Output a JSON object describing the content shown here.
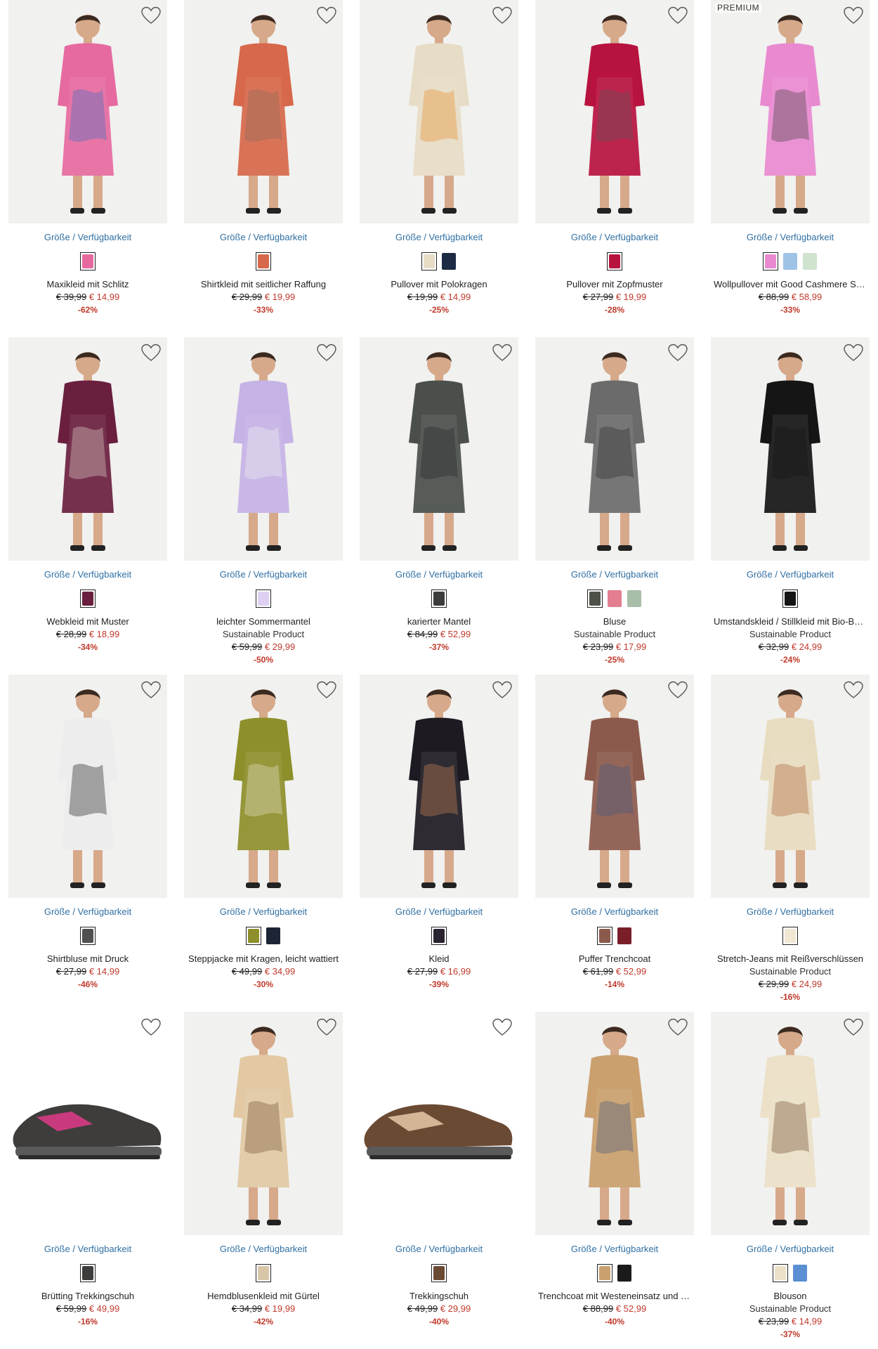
{
  "size_link_label": "Größe / Verfügbarkeit",
  "products": [
    {
      "name": "Maxikleid mit Schlitz",
      "old_price": "€ 39,99",
      "new_price": "€ 14,99",
      "discount": "-62%",
      "badge": "",
      "sustainable": "",
      "bg": "#f1f1ef",
      "garment": "#e66aa0",
      "accent": "#3a6fc4",
      "shoe": false,
      "swatches": [
        "#e66aa0"
      ]
    },
    {
      "name": "Shirtkleid mit seitlicher Raffung",
      "old_price": "€ 29,99",
      "new_price": "€ 19,99",
      "discount": "-33%",
      "badge": "",
      "sustainable": "",
      "bg": "#f1f1ef",
      "garment": "#d7684b",
      "accent": "#8a6a5a",
      "shoe": false,
      "swatches": [
        "#d7684b"
      ]
    },
    {
      "name": "Pullover mit Polokragen",
      "old_price": "€ 19,99",
      "new_price": "€ 14,99",
      "discount": "-25%",
      "badge": "",
      "sustainable": "",
      "bg": "#f1f1ef",
      "garment": "#e7dcc6",
      "accent": "#e8891f",
      "shoe": false,
      "swatches": [
        "#e7dcc6",
        "#1d2a45"
      ]
    },
    {
      "name": "Pullover mit Zopfmuster",
      "old_price": "€ 27,99",
      "new_price": "€ 19,99",
      "discount": "-28%",
      "badge": "",
      "sustainable": "",
      "bg": "#f1f1ef",
      "garment": "#b8123f",
      "accent": "#555555",
      "shoe": false,
      "swatches": [
        "#b8123f"
      ]
    },
    {
      "name": "Wollpullover mit Good Cashmere Standard®-Anteil",
      "old_price": "€ 88,99",
      "new_price": "€ 58,99",
      "discount": "-33%",
      "badge": "PREMIUM",
      "sustainable": "",
      "bg": "#f1f1ef",
      "garment": "#e98ad0",
      "accent": "#3b3b3b",
      "shoe": false,
      "swatches": [
        "#e98ad0",
        "#9ec3e6",
        "#cfe3cf"
      ]
    },
    {
      "name": "Webkleid mit Muster",
      "old_price": "€ 28,99",
      "new_price": "€ 18,99",
      "discount": "-34%",
      "badge": "",
      "sustainable": "",
      "bg": "#f1f1ef",
      "garment": "#6a1f3f",
      "accent": "#e7ddd0",
      "shoe": false,
      "swatches": [
        "#6a1f3f"
      ]
    },
    {
      "name": "leichter Sommermantel",
      "old_price": "€ 59,99",
      "new_price": "€ 29,99",
      "discount": "-50%",
      "badge": "",
      "sustainable": "Sustainable Product",
      "bg": "#f1f1ef",
      "garment": "#c6b3e6",
      "accent": "#f1f1f1",
      "shoe": false,
      "swatches": [
        "#ddd0f2"
      ]
    },
    {
      "name": "karierter Mantel",
      "old_price": "€ 84,99",
      "new_price": "€ 52,99",
      "discount": "-37%",
      "badge": "",
      "sustainable": "",
      "bg": "#f1f1ef",
      "garment": "#4a4f4c",
      "accent": "#222222",
      "shoe": false,
      "swatches": [
        "#3a3d3b"
      ]
    },
    {
      "name": "Bluse",
      "old_price": "€ 23,99",
      "new_price": "€ 17,99",
      "discount": "-25%",
      "badge": "",
      "sustainable": "Sustainable Product",
      "bg": "#f1f1ef",
      "garment": "#6b6b6b",
      "accent": "#2b2b2b",
      "shoe": false,
      "swatches": [
        "#4d5249",
        "#e27e90",
        "#a9bea8"
      ]
    },
    {
      "name": "Umstandskleid / Stillkleid mit Bio-Baumwolle",
      "old_price": "€ 32,99",
      "new_price": "€ 24,99",
      "discount": "-24%",
      "badge": "",
      "sustainable": "Sustainable Product",
      "bg": "#f1f1ef",
      "garment": "#151515",
      "accent": "#151515",
      "shoe": false,
      "swatches": [
        "#151515"
      ]
    },
    {
      "name": "Shirtbluse mit Druck",
      "old_price": "€ 27,99",
      "new_price": "€ 14,99",
      "discount": "-46%",
      "badge": "",
      "sustainable": "",
      "bg": "#f1f1ef",
      "garment": "#ededed",
      "accent": "#111111",
      "shoe": false,
      "swatches": [
        "#505050"
      ]
    },
    {
      "name": "Steppjacke mit Kragen, leicht wattiert",
      "old_price": "€ 49,99",
      "new_price": "€ 34,99",
      "discount": "-30%",
      "badge": "",
      "sustainable": "",
      "bg": "#f1f1ef",
      "garment": "#8d8f2a",
      "accent": "#efe6d3",
      "shoe": false,
      "swatches": [
        "#8d8f2a",
        "#1d2433"
      ]
    },
    {
      "name": "Kleid",
      "old_price": "€ 27,99",
      "new_price": "€ 16,99",
      "discount": "-39%",
      "badge": "",
      "sustainable": "",
      "bg": "#f1f1ef",
      "garment": "#1d1a22",
      "accent": "#d48a5b",
      "shoe": false,
      "swatches": [
        "#2a2430"
      ]
    },
    {
      "name": "Puffer Trenchcoat",
      "old_price": "€ 61,99",
      "new_price": "€ 52,99",
      "discount": "-14%",
      "badge": "",
      "sustainable": "",
      "bg": "#f1f1ef",
      "garment": "#8c5a4c",
      "accent": "#3d5a80",
      "shoe": false,
      "swatches": [
        "#8c5a4c",
        "#7a1f2a"
      ]
    },
    {
      "name": "Stretch-Jeans mit Reißverschlüssen",
      "old_price": "€ 29,99",
      "new_price": "€ 24,99",
      "discount": "-16%",
      "badge": "",
      "sustainable": "Sustainable Product",
      "bg": "#f1f1ef",
      "garment": "#e8dcc0",
      "accent": "#a8592a",
      "shoe": false,
      "swatches": [
        "#f1e8d3"
      ]
    },
    {
      "name": "Brütting Trekkingschuh",
      "old_price": "€ 59,99",
      "new_price": "€ 49,99",
      "discount": "-16%",
      "badge": "",
      "sustainable": "",
      "bg": "#ffffff",
      "garment": "#3f3d3b",
      "accent": "#e03a8a",
      "shoe": true,
      "swatches": [
        "#3f3d3b"
      ]
    },
    {
      "name": "Hemdblusenkleid mit Gürtel",
      "old_price": "€ 34,99",
      "new_price": "€ 19,99",
      "discount": "-42%",
      "badge": "",
      "sustainable": "",
      "bg": "#f1f1ef",
      "garment": "#e2c9a3",
      "accent": "#6b4a2a",
      "shoe": false,
      "swatches": [
        "#d8c6a8"
      ]
    },
    {
      "name": "Trekkingschuh",
      "old_price": "€ 49,99",
      "new_price": "€ 29,99",
      "discount": "-40%",
      "badge": "",
      "sustainable": "",
      "bg": "#ffffff",
      "garment": "#6b4a34",
      "accent": "#e6c9a8",
      "shoe": true,
      "swatches": [
        "#6b4a34"
      ]
    },
    {
      "name": "Trenchcoat mit Westeneinsatz und Kapuze",
      "old_price": "€ 88,99",
      "new_price": "€ 52,99",
      "discount": "-40%",
      "badge": "",
      "sustainable": "",
      "bg": "#f1f1ef",
      "garment": "#caa06e",
      "accent": "#3b5377",
      "shoe": false,
      "swatches": [
        "#caa06e",
        "#1b1b1b"
      ]
    },
    {
      "name": "Blouson",
      "old_price": "€ 23,99",
      "new_price": "€ 14,99",
      "discount": "-37%",
      "badge": "",
      "sustainable": "Sustainable Product",
      "bg": "#f1f1ef",
      "garment": "#ece1c8",
      "accent": "#6b4325",
      "shoe": false,
      "swatches": [
        "#ece1c8",
        "#5b8fd4"
      ]
    }
  ]
}
